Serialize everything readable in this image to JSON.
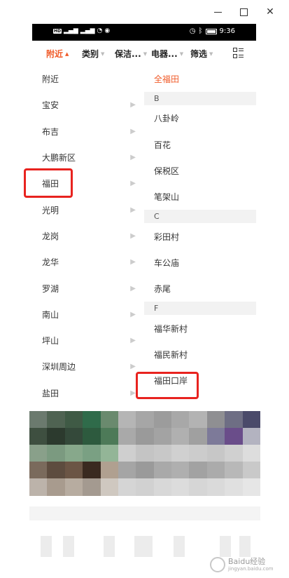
{
  "window": {
    "controls": [
      "minimize",
      "maximize",
      "close"
    ]
  },
  "status_bar": {
    "left_badges": [
      "HD",
      "4G",
      "4G"
    ],
    "time": "9:36"
  },
  "tabs": [
    {
      "label": "附近",
      "active": true
    },
    {
      "label": "类别",
      "active": false
    },
    {
      "label": "保洁...",
      "active": false
    },
    {
      "label": "电器...",
      "active": false
    },
    {
      "label": "筛选",
      "active": false
    }
  ],
  "districts": [
    {
      "label": "附近",
      "has_chevron": false
    },
    {
      "label": "宝安",
      "has_chevron": true
    },
    {
      "label": "布吉",
      "has_chevron": true
    },
    {
      "label": "大鹏新区",
      "has_chevron": true
    },
    {
      "label": "福田",
      "has_chevron": true
    },
    {
      "label": "光明",
      "has_chevron": true
    },
    {
      "label": "龙岗",
      "has_chevron": true
    },
    {
      "label": "龙华",
      "has_chevron": true
    },
    {
      "label": "罗湖",
      "has_chevron": true
    },
    {
      "label": "南山",
      "has_chevron": true
    },
    {
      "label": "坪山",
      "has_chevron": true
    },
    {
      "label": "深圳周边",
      "has_chevron": true
    },
    {
      "label": "盐田",
      "has_chevron": true
    }
  ],
  "areas": [
    {
      "type": "item",
      "label": "全福田",
      "selected": true
    },
    {
      "type": "header",
      "label": "B"
    },
    {
      "type": "item",
      "label": "八卦岭"
    },
    {
      "type": "item",
      "label": "百花"
    },
    {
      "type": "item",
      "label": "保税区"
    },
    {
      "type": "item",
      "label": "笔架山"
    },
    {
      "type": "header",
      "label": "C"
    },
    {
      "type": "item",
      "label": "彩田村"
    },
    {
      "type": "item",
      "label": "车公庙"
    },
    {
      "type": "item",
      "label": "赤尾"
    },
    {
      "type": "header",
      "label": "F"
    },
    {
      "type": "item",
      "label": "福华新村"
    },
    {
      "type": "item",
      "label": "福民新村"
    },
    {
      "type": "item",
      "label": "福田口岸"
    }
  ],
  "colors": {
    "accent": "#f05a28",
    "highlight_box": "#e8231f"
  },
  "watermark": {
    "text": "Baidu经验",
    "sub": "jingyan.baidu.com"
  }
}
